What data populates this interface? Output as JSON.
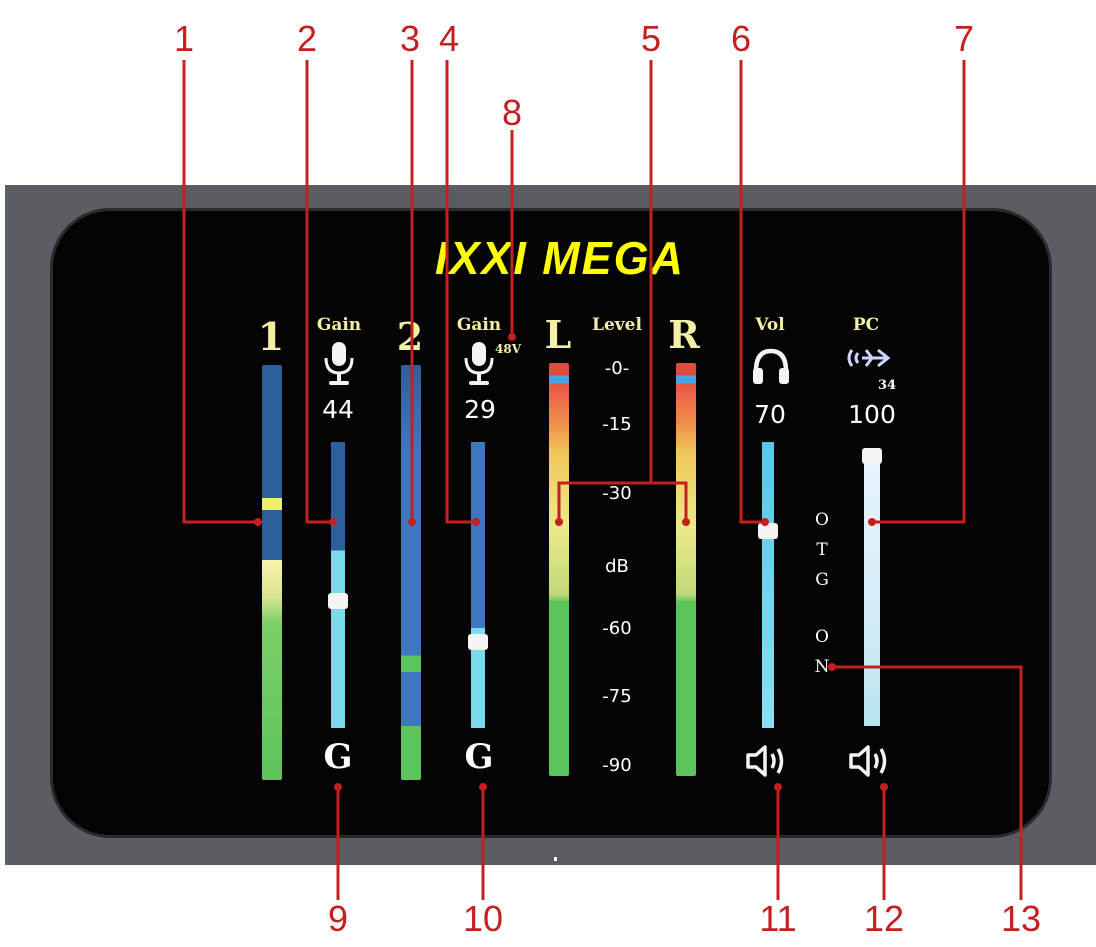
{
  "brand": {
    "logo_text": "IXXI MEGA"
  },
  "channel1": {
    "label": "1"
  },
  "channel2": {
    "label": "2"
  },
  "gain1": {
    "label": "Gain",
    "value": "44",
    "mode": "G"
  },
  "gain2": {
    "label": "Gain",
    "value": "29",
    "mode": "G",
    "phantom": "48V"
  },
  "level": {
    "label": "Level",
    "left": "L",
    "right": "R",
    "unit": "dB",
    "scale": [
      "-0-",
      "-15",
      "-30",
      "-60",
      "-75",
      "-90"
    ]
  },
  "headphone": {
    "label": "Vol",
    "value": "70"
  },
  "pc": {
    "label": "PC",
    "value": "100",
    "sub": "34"
  },
  "otg": {
    "line1": "OTG",
    "line2": "ON"
  },
  "callouts": [
    "1",
    "2",
    "3",
    "4",
    "5",
    "6",
    "7",
    "8",
    "9",
    "10",
    "11",
    "12",
    "13"
  ],
  "levels": {
    "gain1_slider": 0.44,
    "gain2_slider": 0.29,
    "vol_slider": 0.7,
    "pc_slider": 1.0
  },
  "colors": {
    "callout": "#c42020",
    "logo": "#ffff00",
    "label": "#f3f0a6"
  }
}
